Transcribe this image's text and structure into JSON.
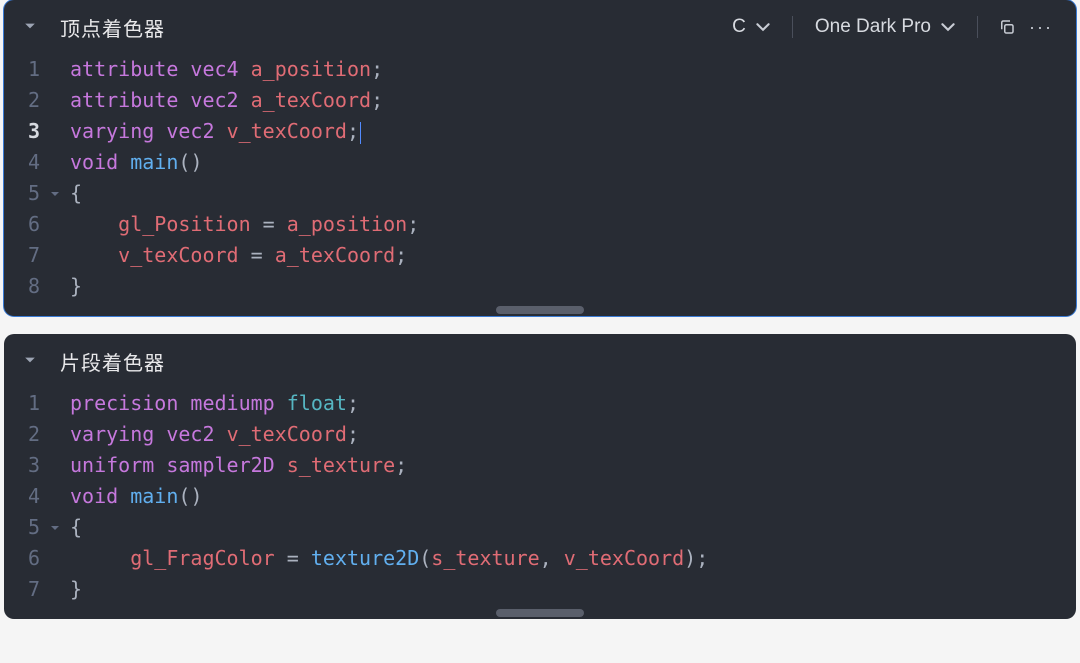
{
  "panels": [
    {
      "title": "顶点着色器",
      "active": true,
      "toolbar": {
        "language": "C",
        "theme": "One Dark Pro"
      },
      "current_line": 3,
      "fold_lines": [
        5
      ],
      "lines": [
        {
          "n": 1,
          "tokens": [
            [
              "kw",
              "attribute"
            ],
            [
              "sp",
              " "
            ],
            [
              "type",
              "vec4"
            ],
            [
              "sp",
              " "
            ],
            [
              "var",
              "a_position"
            ],
            [
              "punc",
              ";"
            ]
          ]
        },
        {
          "n": 2,
          "tokens": [
            [
              "kw",
              "attribute"
            ],
            [
              "sp",
              " "
            ],
            [
              "type",
              "vec2"
            ],
            [
              "sp",
              " "
            ],
            [
              "var",
              "a_texCoord"
            ],
            [
              "punc",
              ";"
            ]
          ]
        },
        {
          "n": 3,
          "cursor_after": true,
          "tokens": [
            [
              "kw",
              "varying"
            ],
            [
              "sp",
              " "
            ],
            [
              "type",
              "vec2"
            ],
            [
              "sp",
              " "
            ],
            [
              "var",
              "v_texCoord"
            ],
            [
              "punc",
              ";"
            ]
          ]
        },
        {
          "n": 4,
          "tokens": [
            [
              "type",
              "void"
            ],
            [
              "sp",
              " "
            ],
            [
              "func",
              "main"
            ],
            [
              "punc",
              "("
            ],
            [
              "punc",
              ")"
            ]
          ]
        },
        {
          "n": 5,
          "tokens": [
            [
              "punc",
              "{"
            ]
          ]
        },
        {
          "n": 6,
          "tokens": [
            [
              "sp",
              "    "
            ],
            [
              "var",
              "gl_Position"
            ],
            [
              "sp",
              " "
            ],
            [
              "op",
              "="
            ],
            [
              "sp",
              " "
            ],
            [
              "var",
              "a_position"
            ],
            [
              "punc",
              ";"
            ]
          ]
        },
        {
          "n": 7,
          "tokens": [
            [
              "sp",
              "    "
            ],
            [
              "var",
              "v_texCoord"
            ],
            [
              "sp",
              " "
            ],
            [
              "op",
              "="
            ],
            [
              "sp",
              " "
            ],
            [
              "var",
              "a_texCoord"
            ],
            [
              "punc",
              ";"
            ]
          ]
        },
        {
          "n": 8,
          "tokens": [
            [
              "punc",
              "}"
            ]
          ]
        }
      ]
    },
    {
      "title": "片段着色器",
      "active": false,
      "toolbar": null,
      "current_line": null,
      "fold_lines": [
        5
      ],
      "lines": [
        {
          "n": 1,
          "tokens": [
            [
              "kw",
              "precision"
            ],
            [
              "sp",
              " "
            ],
            [
              "kw",
              "mediump"
            ],
            [
              "sp",
              " "
            ],
            [
              "builtin",
              "float"
            ],
            [
              "punc",
              ";"
            ]
          ]
        },
        {
          "n": 2,
          "tokens": [
            [
              "kw",
              "varying"
            ],
            [
              "sp",
              " "
            ],
            [
              "type",
              "vec2"
            ],
            [
              "sp",
              " "
            ],
            [
              "var",
              "v_texCoord"
            ],
            [
              "punc",
              ";"
            ]
          ]
        },
        {
          "n": 3,
          "tokens": [
            [
              "kw",
              "uniform"
            ],
            [
              "sp",
              " "
            ],
            [
              "type",
              "sampler2D"
            ],
            [
              "sp",
              " "
            ],
            [
              "var",
              "s_texture"
            ],
            [
              "punc",
              ";"
            ]
          ]
        },
        {
          "n": 4,
          "tokens": [
            [
              "type",
              "void"
            ],
            [
              "sp",
              " "
            ],
            [
              "func",
              "main"
            ],
            [
              "punc",
              "("
            ],
            [
              "punc",
              ")"
            ]
          ]
        },
        {
          "n": 5,
          "tokens": [
            [
              "punc",
              "{"
            ]
          ]
        },
        {
          "n": 6,
          "tokens": [
            [
              "sp",
              "     "
            ],
            [
              "var",
              "gl_FragColor"
            ],
            [
              "sp",
              " "
            ],
            [
              "op",
              "="
            ],
            [
              "sp",
              " "
            ],
            [
              "func",
              "texture2D"
            ],
            [
              "punc",
              "("
            ],
            [
              "var",
              "s_texture"
            ],
            [
              "punc",
              ","
            ],
            [
              "sp",
              " "
            ],
            [
              "var",
              "v_texCoord"
            ],
            [
              "punc",
              ")"
            ],
            [
              "punc",
              ";"
            ]
          ]
        },
        {
          "n": 7,
          "tokens": [
            [
              "punc",
              "}"
            ]
          ]
        }
      ]
    }
  ],
  "icons": {
    "more": "···"
  }
}
